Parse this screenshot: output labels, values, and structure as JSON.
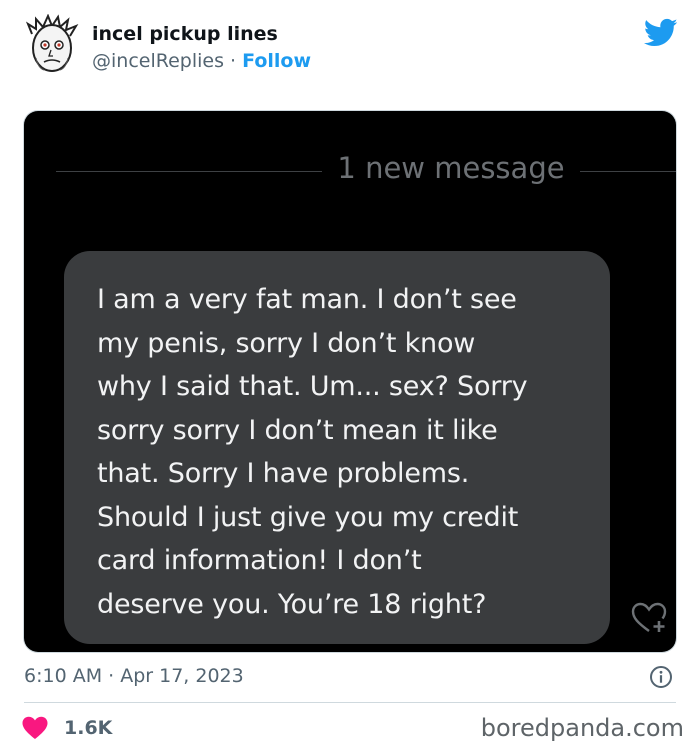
{
  "tweet": {
    "author": {
      "display_name": "incel pickup lines",
      "handle": "@incelReplies",
      "separator": "·",
      "follow_label": "Follow"
    },
    "media": {
      "divider_text": "1 new message",
      "message_lines": [
        "I am a very fat man. I don’t see",
        "my penis, sorry I don’t know",
        "why I said that. Um... sex? Sorry",
        "sorry sorry I don’t mean it like",
        "that. Sorry I have problems.",
        "Should I just give you my credit",
        "card information! I don’t",
        "deserve you. You’re 18 right?"
      ]
    },
    "timestamp": "6:10 AM · Apr 17, 2023",
    "like_count": "1.6K"
  },
  "watermark": "boredpanda.com",
  "colors": {
    "accent": "#1d9bf0",
    "like": "#f91880",
    "bubble": "#3a3c3e"
  },
  "icons": [
    "avatar-face",
    "twitter-bird-icon",
    "heart-plus-icon",
    "info-icon",
    "heart-icon"
  ]
}
